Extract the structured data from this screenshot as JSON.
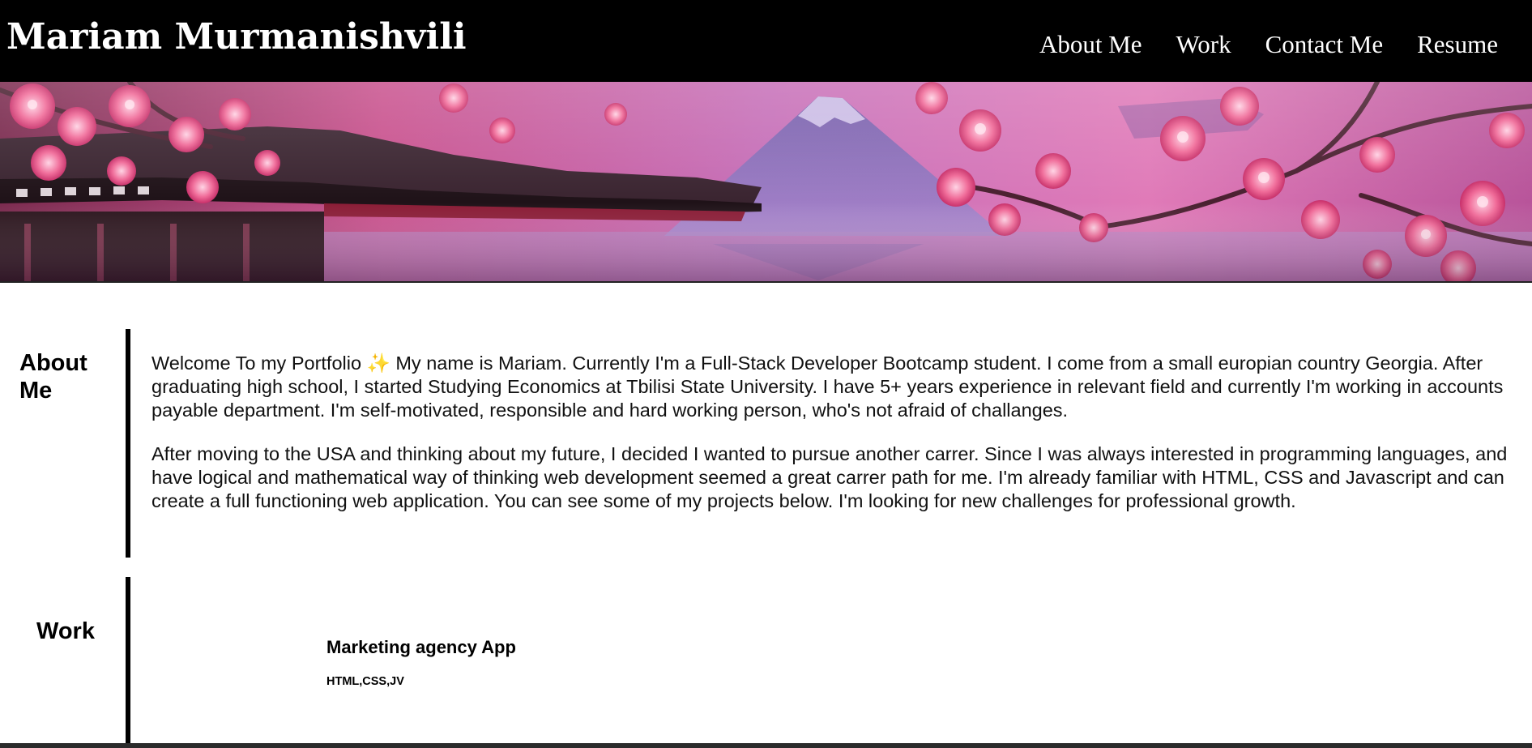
{
  "header": {
    "title": "Mariam Murmanishvili",
    "nav": [
      {
        "label": "About Me"
      },
      {
        "label": "Work"
      },
      {
        "label": "Contact Me"
      },
      {
        "label": "Resume"
      }
    ]
  },
  "about": {
    "heading": "About Me",
    "paragraphs": [
      "Welcome To my Portfolio ✨ My name is Mariam. Currently I'm a Full-Stack Developer Bootcamp student. I come from a small europian country Georgia. After graduating high school, I started Studying Economics at Tbilisi State University. I have 5+ years experience in relevant field and currently I'm working in accounts payable department. I'm self-motivated, responsible and hard working person, who's not afraid of challanges.",
      "After moving to the USA and thinking about my future, I decided I wanted to pursue another carrer. Since I was always interested in programming languages, and have logical and mathematical way of thinking web development seemed a great carrer path for me. I'm already familiar with HTML, CSS and Javascript and can create a full functioning web application. You can see some of my projects below. I'm looking for new challenges for professional growth."
    ]
  },
  "work": {
    "heading": "Work",
    "projects": [
      {
        "title": "Marketing agency App",
        "tech": "HTML,CSS,JV"
      }
    ]
  },
  "colors": {
    "header_bg": "#000000",
    "header_text": "#ffffff",
    "hero_pink": "#e86aa8",
    "hero_purple": "#8a66b8",
    "blossom": "#f27aa0"
  },
  "icons": {
    "hero": "cherry-blossom-pagoda-mountain-banner"
  }
}
